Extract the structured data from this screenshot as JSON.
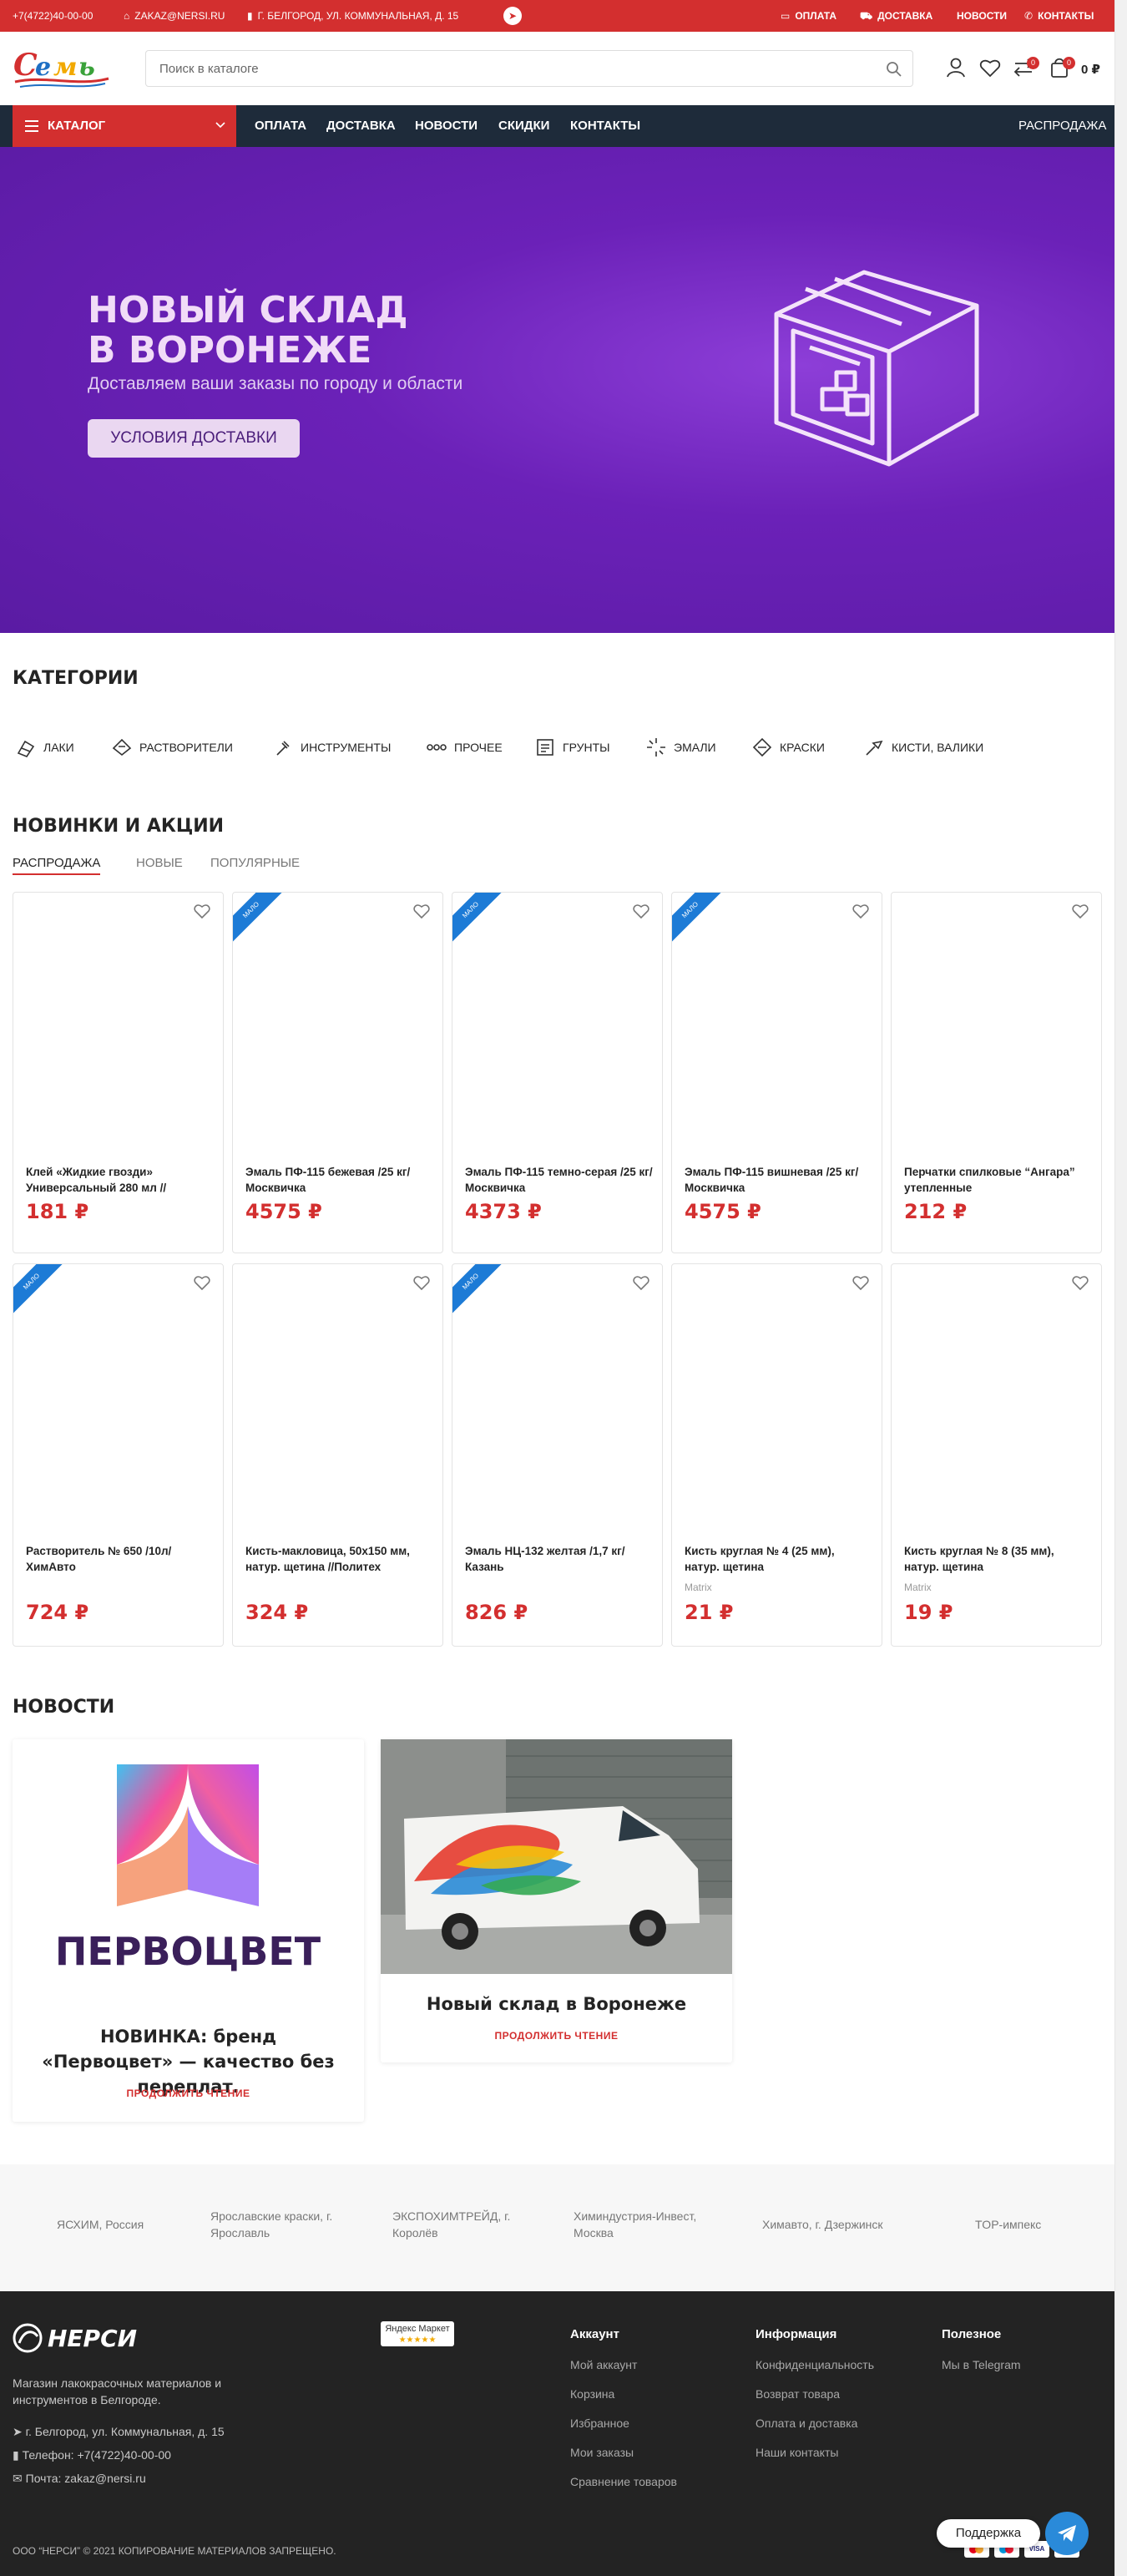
{
  "topbar": {
    "phone": "+7(4722)40-00-00",
    "email": "ZAKAZ@NERSI.RU",
    "address": "Г. БЕЛГОРОД, УЛ. КОММУНАЛЬНАЯ, Д. 15",
    "links": [
      "ОПЛАТА",
      "ДОСТАВКА",
      "НОВОСТИ",
      "КОНТАКТЫ"
    ]
  },
  "header": {
    "logo_text": "Семь",
    "search_placeholder": "Поиск в каталоге",
    "compare_count": "0",
    "cart_count": "0",
    "cart_total": "0 ₽"
  },
  "nav": {
    "catalog_label": "КАТАЛОГ",
    "links": [
      "ОПЛАТА",
      "ДОСТАВКА",
      "НОВОСТИ",
      "СКИДКИ",
      "КОНТАКТЫ"
    ],
    "sale_link": "РАСПРОДАЖА"
  },
  "hero": {
    "title_line1": "НОВЫЙ СКЛАД",
    "title_line2": "В ВОРОНЕЖЕ",
    "subtitle": "Доставляем ваши заказы по городу и области",
    "button": "УСЛОВИЯ ДОСТАВКИ"
  },
  "categories": {
    "title": "КАТЕГОРИИ",
    "items": [
      {
        "label": "ЛАКИ",
        "icon": "lacquer-icon"
      },
      {
        "label": "РАСТВОРИТЕЛИ",
        "icon": "solvent-icon"
      },
      {
        "label": "ИНСТРУМЕНТЫ",
        "icon": "tools-icon"
      },
      {
        "label": "ПРОЧЕЕ",
        "icon": "other-icon"
      },
      {
        "label": "ГРУНТЫ",
        "icon": "primer-icon"
      },
      {
        "label": "ЭМАЛИ",
        "icon": "enamel-icon"
      },
      {
        "label": "КРАСКИ",
        "icon": "paint-icon"
      },
      {
        "label": "КИСТИ, ВАЛИКИ",
        "icon": "brush-icon"
      }
    ]
  },
  "products": {
    "title": "НОВИНКИ И АКЦИИ",
    "tabs": [
      "РАСПРОДАЖА",
      "НОВЫЕ",
      "ПОПУЛЯРНЫЕ"
    ],
    "ribbon_label": "МАЛО",
    "items": [
      {
        "name": "Клей «Жидкие гвозди» Универсальный 280 мл //",
        "price": "181 ₽",
        "ribbon": false,
        "brand": ""
      },
      {
        "name": "Эмаль ПФ-115 бежевая /25 кг/ Москвичка",
        "price": "4575 ₽",
        "ribbon": true,
        "brand": ""
      },
      {
        "name": "Эмаль ПФ-115 темно-серая /25 кг/ Москвичка",
        "price": "4373 ₽",
        "ribbon": true,
        "brand": ""
      },
      {
        "name": "Эмаль ПФ-115 вишневая /25 кг/ Москвичка",
        "price": "4575 ₽",
        "ribbon": true,
        "brand": ""
      },
      {
        "name": "Перчатки спилковые “Ангара” утепленные",
        "price": "212 ₽",
        "ribbon": false,
        "brand": ""
      },
      {
        "name": "Растворитель № 650 /10л/ ХимАвто",
        "price": "724 ₽",
        "ribbon": true,
        "brand": ""
      },
      {
        "name": "Кисть-макловица, 50х150 мм, натур. щетина //Политех",
        "price": "324 ₽",
        "ribbon": false,
        "brand": ""
      },
      {
        "name": "Эмаль НЦ-132 желтая /1,7 кг/ Казань",
        "price": "826 ₽",
        "ribbon": true,
        "brand": ""
      },
      {
        "name": "Кисть круглая № 4 (25 мм), натур. щетина",
        "price": "21 ₽",
        "ribbon": false,
        "brand": "Matrix"
      },
      {
        "name": "Кисть круглая № 8 (35 мм), натур. щетина",
        "price": "19 ₽",
        "ribbon": false,
        "brand": "Matrix"
      }
    ]
  },
  "news": {
    "title": "НОВОСТИ",
    "items": [
      {
        "title": "НОВИНКА: бренд «Первоцвет» — качество без переплат.",
        "more": "ПРОДОЛЖИТЬ ЧТЕНИЕ",
        "image_text": "ПЕРВОЦВЕТ"
      },
      {
        "title": "Новый склад в Воронеже",
        "more": "ПРОДОЛЖИТЬ ЧТЕНИЕ"
      }
    ]
  },
  "brands": [
    "ЯСХИМ, Россия",
    "Ярославские краски, г. Ярославль",
    "ЭКСПОХИМТРЕЙД, г. Королёв",
    "Химиндустрия-Инвест, Москва",
    "Химавто, г. Дзержинск",
    "TOP-импекс"
  ],
  "footer": {
    "logo_text": "НЕРСИ",
    "market_badge": "Яндекс Маркет",
    "about": "Магазин лакокрасочных материалов и инструментов в Белгороде.",
    "address": "г. Белгород, ул. Коммунальная, д. 15",
    "phone": "Телефон: +7(4722)40-00-00",
    "email": "Почта: zakaz@nersi.ru",
    "columns": [
      {
        "title": "Аккаунт",
        "links": [
          "Мой аккаунт",
          "Корзина",
          "Избранное",
          "Мои заказы",
          "Сравнение товаров"
        ]
      },
      {
        "title": "Информация",
        "links": [
          "Конфиденциальность",
          "Возврат товара",
          "Оплата и доставка",
          "Наши контакты"
        ]
      },
      {
        "title": "Полезное",
        "links": [
          "Мы в Telegram"
        ]
      }
    ],
    "copyright": "ООО “НЕРСИ” © 2021 КОПИРОВАНИЕ МАТЕРИАЛОВ ЗАПРЕЩЕНО.",
    "support_label": "Поддержка"
  },
  "colors": {
    "brand_red": "#d32f2f",
    "nav_dark": "#1e2b3a",
    "hero_purple": "#6b21b8",
    "footer_dark": "#232323"
  }
}
